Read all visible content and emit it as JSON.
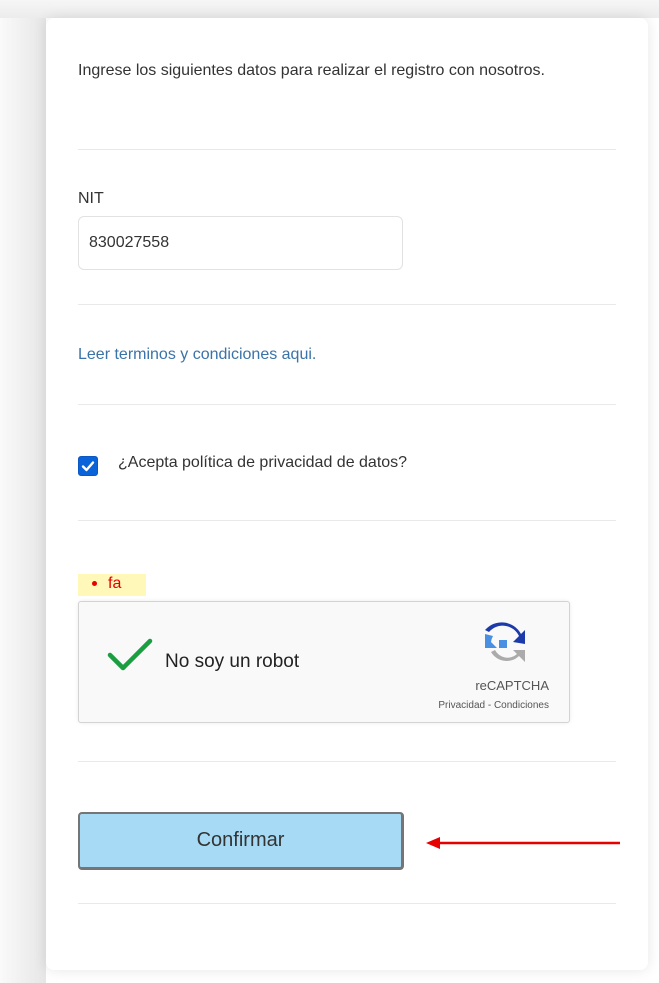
{
  "form": {
    "intro_text": "Ingrese los siguientes datos para realizar el registro con nosotros.",
    "nit_label": "NIT",
    "nit_value": "830027558",
    "terms_link": "Leer terminos y condiciones aqui.",
    "privacy_label": "¿Acepta política de privacidad de datos?",
    "privacy_checked": true,
    "error_message": "fa",
    "confirm_label": "Confirmar"
  },
  "recaptcha": {
    "label": "No soy un robot",
    "brand": "reCAPTCHA",
    "links": "Privacidad - Condiciones",
    "verified": true
  },
  "colors": {
    "link": "#3a73a8",
    "checkbox": "#0b63d9",
    "error": "#e60000",
    "error_bg": "#fff8b8",
    "button_bg": "#a7dbf5",
    "annotation_arrow": "#e60000",
    "check_green": "#1a9e3f"
  }
}
